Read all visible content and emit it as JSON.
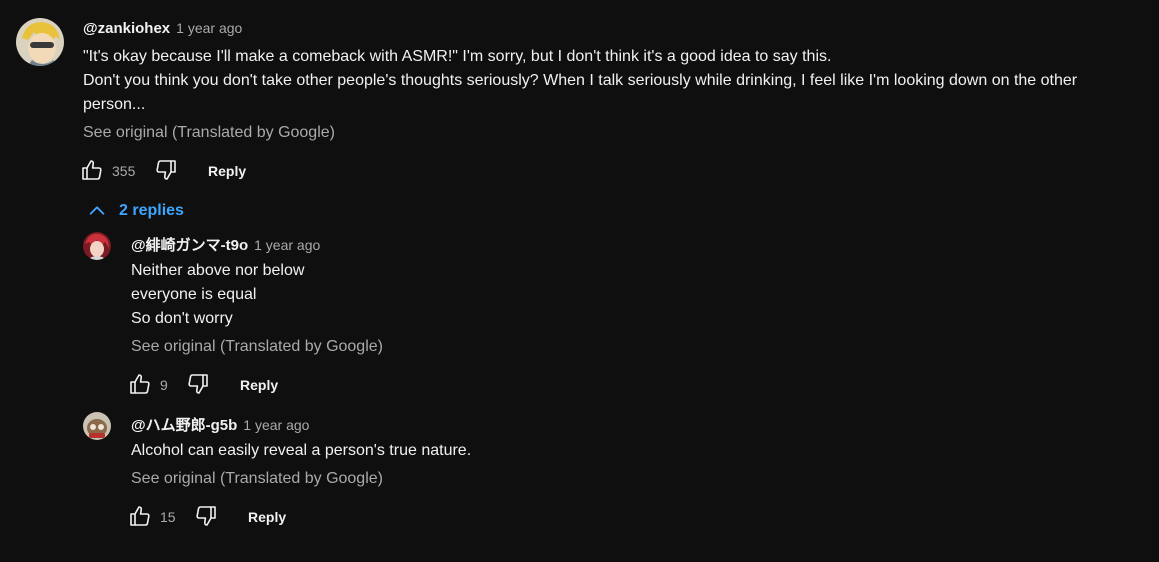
{
  "comment": {
    "handle": "@zankiohex",
    "time": "1 year ago",
    "lines": [
      "\"It's okay because I'll make a comeback with ASMR!\" I'm sorry, but I don't think it's a good idea to say this.",
      "Don't you think you don't take other people's thoughts seriously? When I talk seriously while drinking, I feel like I'm looking down on the other",
      "person..."
    ],
    "see_original": "See original (Translated by Google)",
    "likes": "355",
    "reply_label": "Reply"
  },
  "replies_toggle": "2 replies",
  "replies": [
    {
      "handle": "@緋崎ガンマ-t9o",
      "time": "1 year ago",
      "lines": [
        "Neither above nor below",
        "everyone is equal",
        "So don't worry"
      ],
      "see_original": "See original (Translated by Google)",
      "likes": "9",
      "reply_label": "Reply"
    },
    {
      "handle": "@ハム野郎-g5b",
      "time": "1 year ago",
      "lines": [
        "Alcohol can easily reveal a person's true nature."
      ],
      "see_original": "See original (Translated by Google)",
      "likes": "15",
      "reply_label": "Reply"
    }
  ],
  "colors": {
    "background": "#0f0f0f",
    "text": "#f1f1f1",
    "secondary": "#aaaaaa",
    "link": "#3ea6ff"
  },
  "icons": [
    "thumbs-up-icon",
    "thumbs-down-icon",
    "chevron-up-icon"
  ]
}
